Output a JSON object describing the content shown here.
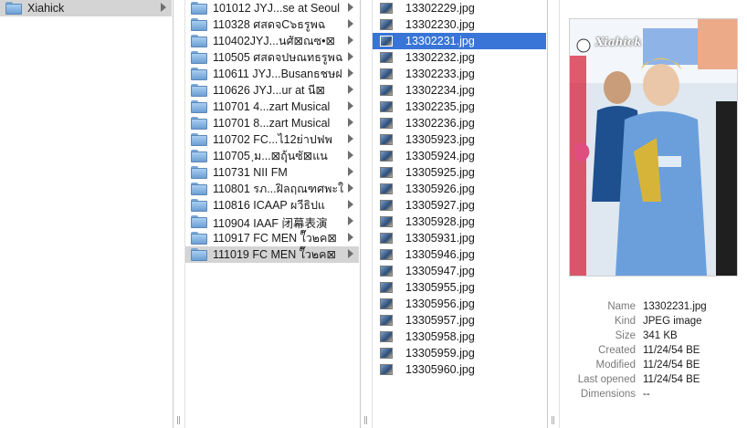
{
  "column1": {
    "items": [
      {
        "label": "Xiahick",
        "type": "folder",
        "selected": true,
        "has_children": true
      }
    ]
  },
  "column2": {
    "items": [
      {
        "label": "101012 JYJ...se at Seoul"
      },
      {
        "label": "110328 ศสดจC๖ธรูพฉ"
      },
      {
        "label": "110402JYJ...นศั⊠ณซ•⊠"
      },
      {
        "label": "110505 ศสดจปษณทธรูพฉ"
      },
      {
        "label": "110611 JYJ...Busanธชษฝ"
      },
      {
        "label": "110626 JYJ...ur at นี⊠"
      },
      {
        "label": "110701 4...zart Musical"
      },
      {
        "label": "110701 8...zart Musical"
      },
      {
        "label": "110702 FC...ไ12ย่าปฟพ"
      },
      {
        "label": "110705 ฺม...⊠ฤุ้นซั⊠แน"
      },
      {
        "label": "110731 NII FM"
      },
      {
        "label": "110801 รภ...ฝิลฤณฑศพะใ"
      },
      {
        "label": "110816 ICAAP ผวีธิปแ"
      },
      {
        "label": "110904 IAAF 闭幕表演"
      },
      {
        "label": "110917 FC MEN ใ๊ว๒ค⊠"
      },
      {
        "label": "111019 FC MEN ใ๊ว๒ค⊠",
        "selected": true
      }
    ]
  },
  "column3": {
    "items": [
      "13302229.jpg",
      "13302230.jpg",
      "13302231.jpg",
      "13302232.jpg",
      "13302233.jpg",
      "13302234.jpg",
      "13302235.jpg",
      "13302236.jpg",
      "13305923.jpg",
      "13305924.jpg",
      "13305925.jpg",
      "13305926.jpg",
      "13305927.jpg",
      "13305928.jpg",
      "13305931.jpg",
      "13305946.jpg",
      "13305947.jpg",
      "13305955.jpg",
      "13305956.jpg",
      "13305957.jpg",
      "13305958.jpg",
      "13305959.jpg",
      "13305960.jpg"
    ],
    "selected_index": 2
  },
  "preview": {
    "watermark": "Xiahick",
    "info": [
      {
        "key": "Name",
        "value": "13302231.jpg"
      },
      {
        "key": "Kind",
        "value": "JPEG image"
      },
      {
        "key": "Size",
        "value": "341 KB"
      },
      {
        "key": "Created",
        "value": "11/24/54 BE"
      },
      {
        "key": "Modified",
        "value": "11/24/54 BE"
      },
      {
        "key": "Last opened",
        "value": "11/24/54 BE"
      },
      {
        "key": "Dimensions",
        "value": "--"
      }
    ]
  },
  "colors": {
    "selection_blue": "#3875d7",
    "selection_gray": "#d4d4d4",
    "folder_blue": "#6d9fd3"
  },
  "icons": {
    "folder": "folder-icon",
    "image": "jpeg-file-icon",
    "disclosure": "chevron-right-icon",
    "column_resize": "column-resize-grip-icon"
  }
}
